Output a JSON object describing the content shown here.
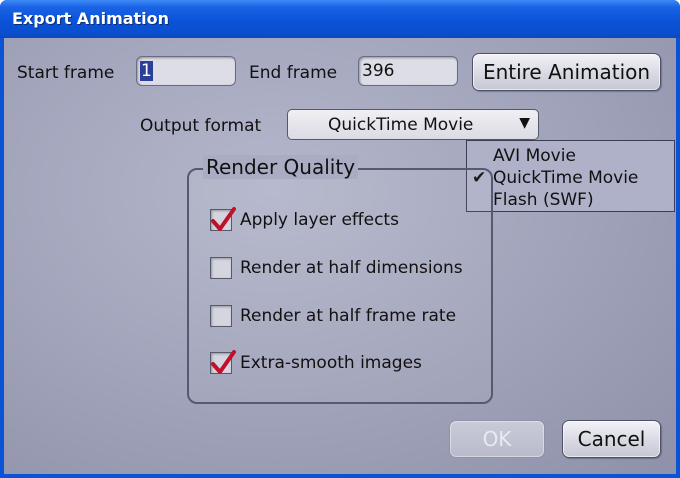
{
  "window": {
    "title": "Export Animation"
  },
  "frames": {
    "start_label": "Start frame",
    "start_value": "1",
    "end_label": "End frame",
    "end_value": "396",
    "entire_button": "Entire Animation"
  },
  "output": {
    "label": "Output format",
    "selected": "QuickTime Movie",
    "arrow": "▼",
    "options": [
      {
        "label": "AVI Movie",
        "checked": false
      },
      {
        "label": "QuickTime Movie",
        "checked": true
      },
      {
        "label": "Flash (SWF)",
        "checked": false
      }
    ],
    "check_glyph": "✔"
  },
  "render_quality": {
    "title": "Render Quality",
    "options": [
      {
        "label": "Apply layer effects",
        "checked": true
      },
      {
        "label": "Render at half dimensions",
        "checked": false
      },
      {
        "label": "Render at half frame rate",
        "checked": false
      },
      {
        "label": "Extra-smooth images",
        "checked": true
      }
    ]
  },
  "buttons": {
    "ok": "OK",
    "cancel": "Cancel"
  },
  "colors": {
    "titlebar": "#0a52d8",
    "checkmark": "#c0102a"
  }
}
